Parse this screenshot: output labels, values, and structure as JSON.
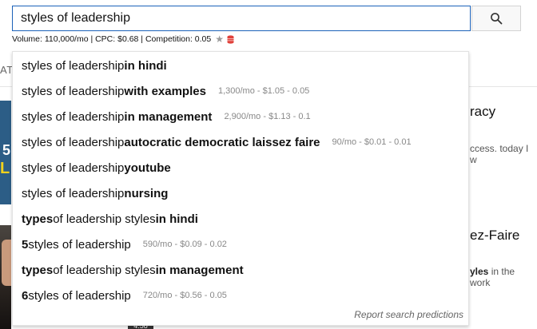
{
  "search": {
    "query": "styles of leadership ",
    "button_icon": "search-icon"
  },
  "stats": {
    "text": "Volume: 110,000/mo | CPC: $0.68 | Competition: 0.05",
    "star_icon": "star-icon",
    "db_icon": "database-icon",
    "db_color": "#e0403a"
  },
  "suggestions": [
    {
      "base": "styles of leadership",
      "suffix": " in hindi",
      "meta": ""
    },
    {
      "base": "styles of leadership",
      "suffix": " with examples",
      "meta": "1,300/mo - $1.05 - 0.05"
    },
    {
      "base": "styles of leadership",
      "suffix": " in management",
      "meta": "2,900/mo - $1.13 - 0.1"
    },
    {
      "base": "styles of leadership",
      "suffix": " autocratic democratic laissez faire",
      "meta": "90/mo - $0.01 - 0.01"
    },
    {
      "base": "styles of leadership",
      "suffix": " youtube",
      "meta": ""
    },
    {
      "base": "styles of leadership",
      "suffix": " nursing",
      "meta": ""
    },
    {
      "pre_bold": "types",
      "base": " of leadership styles",
      "suffix": " in hindi",
      "meta": ""
    },
    {
      "pre_bold": "5",
      "base": " styles of leadership",
      "suffix": "",
      "meta": "590/mo - $0.09 - 0.02"
    },
    {
      "pre_bold": "types",
      "base": " of leadership styles",
      "suffix": " in management",
      "meta": ""
    },
    {
      "pre_bold": "6",
      "base": " styles of leadership",
      "suffix": "",
      "meta": "720/mo - $0.56 - 0.05"
    }
  ],
  "footer_link": "Report search predictions",
  "background": {
    "tab_fragment": "ATE",
    "thumb_text_1": "5",
    "thumb_text_2": "L",
    "result_title_1": "racy",
    "result_snippet_1": "ccess. today I w",
    "result_title_2": "ez-Faire",
    "result_snippet_2_bold": "yles",
    "result_snippet_2": " in the work",
    "duration": "4:58"
  },
  "colors": {
    "input_border": "#1c62b9",
    "meta_text": "#888888"
  }
}
